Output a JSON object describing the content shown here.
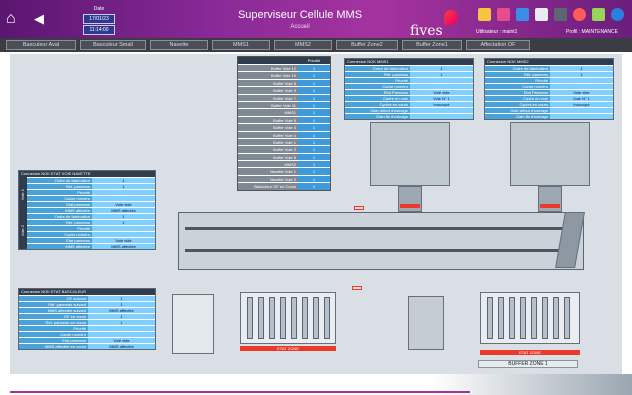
{
  "header": {
    "date_label": "Date",
    "date_value": "17/01/23",
    "time_value": "11:14:00",
    "title": "Superviseur Cellule MMS",
    "subtitle": "Accueil",
    "logo_text": "fives",
    "user_text": "Utilisateur : maint1",
    "profile_text": "Profil : MAINTENANCE"
  },
  "tabs": [
    "Basculeur Aval",
    "Basculeur Small",
    "Navette",
    "MMS1",
    "MMS2",
    "Buffer Zone2",
    "Buffer Zone1",
    "Affectation OF"
  ],
  "priority": {
    "header_name": "",
    "header_value": "Priorité",
    "rows": [
      {
        "name": "Buffer Voie 12",
        "value": "1"
      },
      {
        "name": "Buffer Voie 10",
        "value": "1"
      },
      {
        "name": "Buffer Voie 8",
        "value": "1"
      },
      {
        "name": "Buffer Voie 9",
        "value": "1"
      },
      {
        "name": "Buffer Voie 7",
        "value": "1"
      },
      {
        "name": "Buffer Voie 11",
        "value": "1"
      },
      {
        "name": "MMS1",
        "value": "1"
      },
      {
        "name": "Buffer Voie 5",
        "value": "1"
      },
      {
        "name": "Buffer Voie 3",
        "value": "1"
      },
      {
        "name": "Buffer Voie 4",
        "value": "1"
      },
      {
        "name": "Buffer Voie 1",
        "value": "1"
      },
      {
        "name": "Buffer Voie 2",
        "value": "1"
      },
      {
        "name": "Buffer Voie 6",
        "value": "1"
      },
      {
        "name": "MMS2",
        "value": "1"
      },
      {
        "name": "Navette Voie 1",
        "value": "1"
      },
      {
        "name": "Navette Voie 2",
        "value": "1"
      },
      {
        "name": "Basculeur OF en Cours",
        "value": "1"
      }
    ]
  },
  "mms1": {
    "title": "Connexion NOK   MMS1",
    "rows": [
      {
        "label": "Ordre de fabrication",
        "value": "1"
      },
      {
        "label": "Réf. panneau",
        "value": "1"
      },
      {
        "label": "Priorité",
        "value": ""
      },
      {
        "label": "Cadre numéro",
        "value": ""
      },
      {
        "label": "Etat Panneau",
        "value": "Voie vide"
      },
      {
        "label": "Cadre en voie",
        "value": "Voie N°  1"
      },
      {
        "label": "Cycles en cours",
        "value": "Inoccupé"
      },
      {
        "label": "Gain début d'usinage",
        "value": ""
      },
      {
        "label": "Gain fin d'usinage",
        "value": ""
      }
    ]
  },
  "mms2": {
    "title": "Connexion NOK   MMS2",
    "rows": [
      {
        "label": "Ordre de fabrication",
        "value": "1"
      },
      {
        "label": "Réf. panneau",
        "value": "1"
      },
      {
        "label": "Priorité",
        "value": ""
      },
      {
        "label": "Cadre numéro",
        "value": ""
      },
      {
        "label": "Etat Panneau",
        "value": "Voie vide"
      },
      {
        "label": "Cadre en voie",
        "value": "Voie N°  1"
      },
      {
        "label": "Cycles en cours",
        "value": "Inoccupé"
      },
      {
        "label": "Gain début d'usinage",
        "value": ""
      },
      {
        "label": "Gain fin d'usinage",
        "value": ""
      }
    ]
  },
  "navette": {
    "title": "Connexion NOK   ETAT VOIE NAVETTE",
    "voie1_label": "Voie 1",
    "voie2_label": "Voie 2",
    "rows1": [
      {
        "label": "Ordre de fabrication",
        "value": "1"
      },
      {
        "label": "Réf. panneau",
        "value": "1"
      },
      {
        "label": "Priorité",
        "value": ""
      },
      {
        "label": "Cadre numéro",
        "value": ""
      },
      {
        "label": "Etat panneau",
        "value": "Voie vide"
      },
      {
        "label": "MMS affectée",
        "value": "MMS affectée"
      }
    ],
    "rows2": [
      {
        "label": "Ordre de fabrication",
        "value": "1"
      },
      {
        "label": "Réf. panneau",
        "value": "1"
      },
      {
        "label": "Priorité",
        "value": ""
      },
      {
        "label": "Cadre numéro",
        "value": ""
      },
      {
        "label": "Etat panneau",
        "value": "Voie vide"
      },
      {
        "label": "MMS affectée",
        "value": "MMS affectée"
      }
    ]
  },
  "basculeur": {
    "title": "Connexion NOK   ETAT BASCULEUR",
    "rows": [
      {
        "label": "OF suivant",
        "value": "1"
      },
      {
        "label": "Réf. panneau suivant",
        "value": "1"
      },
      {
        "label": "MMS affectée suivant",
        "value": "MMS affectée"
      },
      {
        "label": "OF en cours",
        "value": "1"
      },
      {
        "label": "Réf. panneau en cours",
        "value": "1"
      },
      {
        "label": "Priorité",
        "value": ""
      },
      {
        "label": "Cadre numéro",
        "value": ""
      },
      {
        "label": "Etat panneau",
        "value": "Voie vide"
      },
      {
        "label": "MMS affectée en cours",
        "value": "MMS affectée"
      }
    ]
  },
  "zones": {
    "zone2": "ETAT ZONE",
    "zone1": "ETAT ZONE",
    "zone1_label": "BUFFER ZONE 1"
  },
  "colors": {
    "brand": "#a5339f",
    "panel_blue": "#4aa3d8",
    "alarm_red": "#ec3a2a"
  }
}
